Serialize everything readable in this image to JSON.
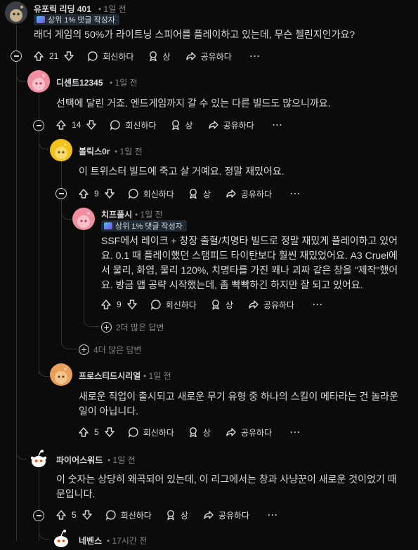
{
  "comments": [
    {
      "id": "c1",
      "username": "유포릭 리딩 401",
      "time": "1일 전",
      "flair": "상위 1% 댓글 작성자",
      "body": "래더 게임의 50%가 라이트닝 스피어를 플레이하고 있는데, 무슨 첼린지인가요?",
      "votes": "21",
      "reply_label": "회신하다",
      "award_label": "상",
      "share_label": "공유하다",
      "avatar_color": "#c7b08f"
    },
    {
      "id": "c2",
      "username": "디센트12345",
      "time": "1일 전",
      "body": "선택에 달린 거죠. 엔드게임까지 갈 수 있는 다른 빌드도 많으니까요.",
      "votes": "14",
      "reply_label": "회신하다",
      "award_label": "상",
      "share_label": "공유하다",
      "avatar_color": "#f08fa0"
    },
    {
      "id": "c3",
      "username": "볼릭스0r",
      "time": "1일 전",
      "body": "이 트위스터 빌드에 죽고 살 거예요. 정말 재밌어요.",
      "votes": "9",
      "reply_label": "회신하다",
      "award_label": "상",
      "share_label": "공유하다",
      "avatar_color": "#f2c21a"
    },
    {
      "id": "c4",
      "username": "치프풀시",
      "time": "1일 전",
      "flair": "상위 1% 댓글 작성자",
      "body_lines": [
        "SSF에서 레이크 + 창장 출혈/치명타 빌드로 정말 재밌게 플레이하고 있어",
        "요. 0.1 때 플레이했던 스탬피드 타이탄보다 훨씬 재밌었어요. A3 Cruel에",
        "서 물리, 화염, 물리 120%, 치명타를 가진 꽤나 괴짜 같은 창을 \"제작\"했어",
        "요. 방금 맵 공략 시작했는데, 좀 빡빡하긴 하지만 잘 되고 있어요."
      ],
      "votes": "9",
      "reply_label": "회신하다",
      "award_label": "상",
      "share_label": "공유하다",
      "avatar_color": "#f08fa0"
    },
    {
      "id": "c5",
      "username": "프로스티드시리얼",
      "time": "1일 전",
      "body_lines": [
        "새로운 직업이 출시되고 새로운 무기 유형 중 하나의 스킬이 메타라는 건 놀라운",
        "일이 아닙니다."
      ],
      "votes": "5",
      "reply_label": "회신하다",
      "award_label": "상",
      "share_label": "공유하다",
      "avatar_color": "#e8a05a"
    },
    {
      "id": "c6",
      "username": "파이어스워드",
      "time": "1일 전",
      "body_lines": [
        "이 숫자는 상당히 왜곡되어 있는데, 이 리그에서는 창과 사냥꾼이 새로운 것이었기 때",
        "문입니다."
      ],
      "votes": "5",
      "reply_label": "회신하다",
      "award_label": "상",
      "share_label": "공유하다",
      "avatar_color": "#ffffff"
    },
    {
      "id": "c7",
      "username": "네벤스",
      "time": "17시간 전",
      "avatar_color": "#ffffff"
    }
  ],
  "more_replies": {
    "two": "2더 많은 답변",
    "four": "4더 많은 답변"
  },
  "overflow_glyph": "···",
  "date_separator": "•"
}
